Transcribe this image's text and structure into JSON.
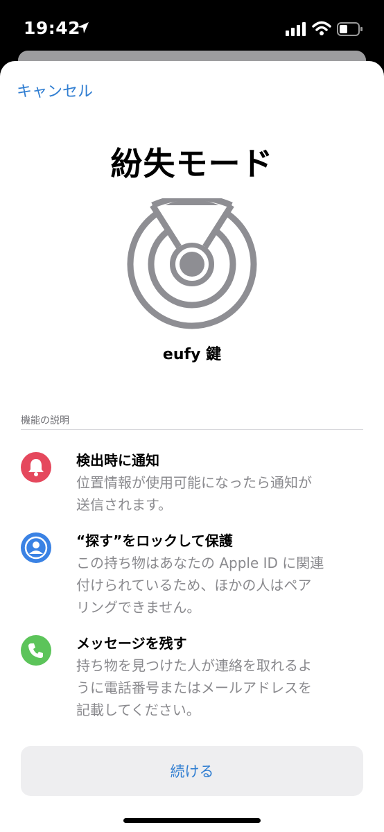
{
  "status_bar": {
    "time": "19:42"
  },
  "header": {
    "cancel_label": "キャンセル"
  },
  "main": {
    "title": "紛失モード",
    "item_name": "eufy 鍵",
    "section_header": "機能の説明",
    "features": [
      {
        "icon": "bell-icon",
        "color": "#e5485d",
        "title": "検出時に通知",
        "desc_lines": [
          "位置情報が使用可能になったら通知が",
          "送信されます。"
        ]
      },
      {
        "icon": "person-icon",
        "color": "#3a82e4",
        "title": "“探す”をロックして保護",
        "desc_lines": [
          "この持ち物はあなたの Apple ID に関連",
          "付けられているため、ほかの人はペア",
          "リングできません。"
        ]
      },
      {
        "icon": "phone-icon",
        "color": "#5cc45a",
        "title": "メッセージを残す",
        "desc_lines": [
          "持ち物を見つけた人が連絡を取れるよ",
          "うに電話番号またはメールアドレスを",
          "記載してください。"
        ]
      }
    ]
  },
  "footer": {
    "continue_label": "続ける"
  },
  "colors": {
    "accent": "#2f7dd1",
    "radar_gray": "#8e8e93"
  }
}
